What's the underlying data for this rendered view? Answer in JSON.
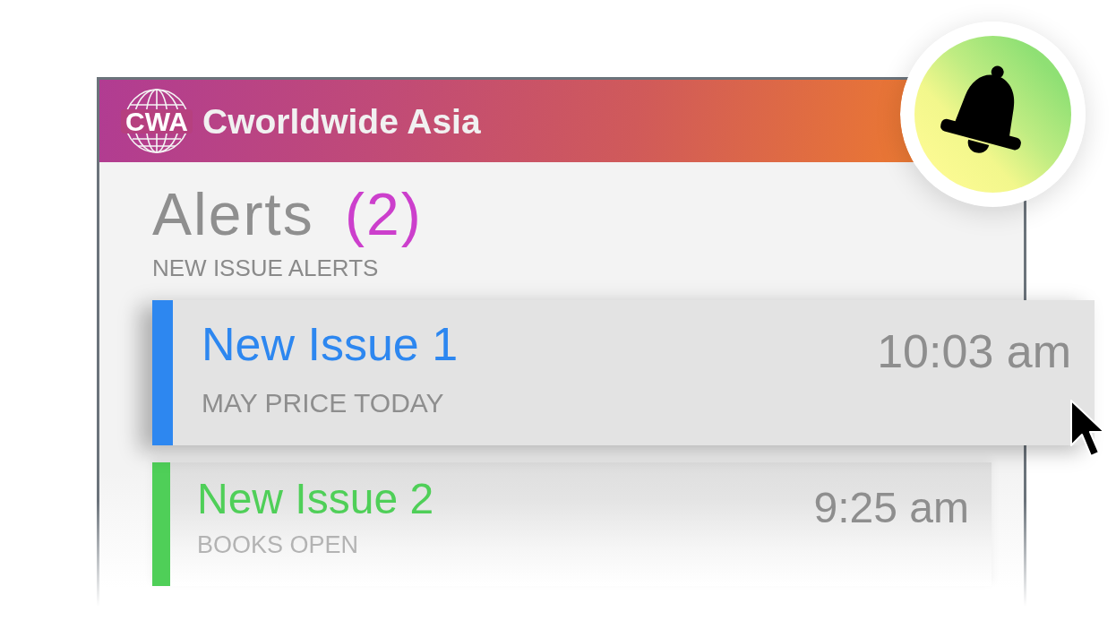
{
  "header": {
    "logo_text": "CWA",
    "brand": "Cworldwide Asia"
  },
  "heading": {
    "title": "Alerts",
    "count": "(2)",
    "subtitle": "NEW ISSUE ALERTS"
  },
  "alerts": [
    {
      "title": "New Issue 1",
      "detail": "MAY PRICE TODAY",
      "time": "10:03 am",
      "color": "#2d87f0",
      "selected": true
    },
    {
      "title": "New Issue 2",
      "detail": "BOOKS OPEN",
      "time": "9:25 am",
      "color": "#4fcf58",
      "selected": false
    }
  ]
}
